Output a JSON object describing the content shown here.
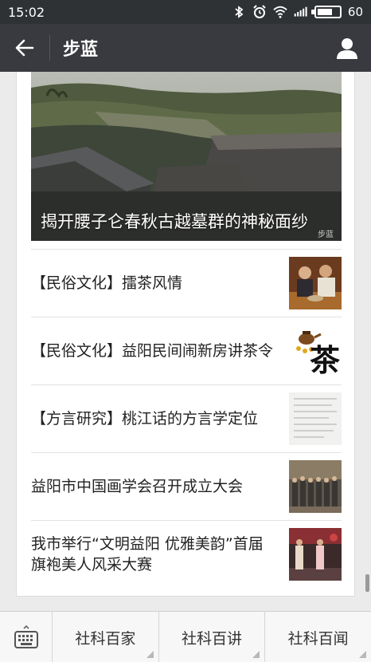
{
  "status_bar": {
    "time": "15:02",
    "battery_level": "60",
    "icons": [
      "bluetooth-icon",
      "alarm-icon",
      "wifi-icon",
      "signal-icon",
      "battery-icon"
    ]
  },
  "nav": {
    "title": "步蓝"
  },
  "cover": {
    "title": "揭开腰子仑春秋古越墓群的神秘面纱",
    "watermark": "步蓝"
  },
  "articles": [
    {
      "title": "【民俗文化】擂茶风情"
    },
    {
      "title": "【民俗文化】益阳民间闹新房讲茶令",
      "thumb_text": "茶"
    },
    {
      "title": "【方言研究】桃江话的方言学定位"
    },
    {
      "title": "益阳市中国画学会召开成立大会"
    },
    {
      "title": "我市举行“文明益阳 优雅美韵”首届旗袍美人风采大赛"
    }
  ],
  "bottom_menu": [
    {
      "label": "社科百家"
    },
    {
      "label": "社科百讲"
    },
    {
      "label": "社科百闻"
    }
  ],
  "colors": {
    "status_bar": "#2f3234",
    "nav_bar": "#393a3f",
    "background": "#ebebeb",
    "bottom_bar": "#f7f7f7"
  }
}
